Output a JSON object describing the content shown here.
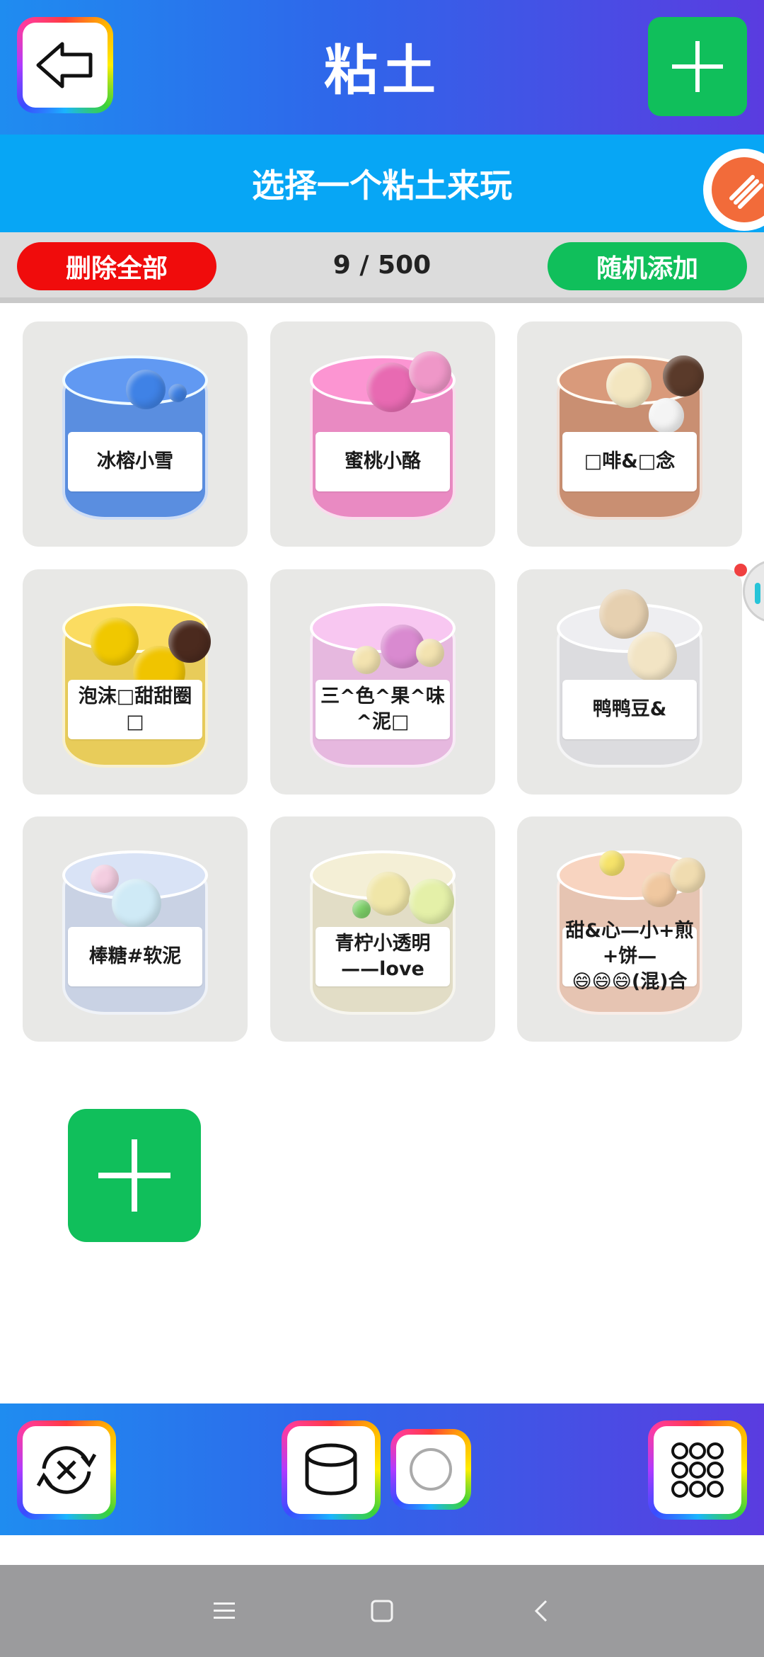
{
  "header": {
    "title": "粘土",
    "back_icon": "arrow-left-icon",
    "add_icon": "plus-icon"
  },
  "subtitle": {
    "text": "选择一个粘土来玩",
    "brush_icon": "brush-icon"
  },
  "controls": {
    "delete_all_label": "删除全部",
    "counter": "9 / 500",
    "random_add_label": "随机添加"
  },
  "slimes": [
    {
      "name": "冰榕小雪",
      "color": "#5a8ee0"
    },
    {
      "name": "蜜桃小酪",
      "color": "#e98ac2"
    },
    {
      "name": "□啡&□念",
      "color": "#c98f72"
    },
    {
      "name": "泡沫□甜甜圈□",
      "color": "#e8cc5a"
    },
    {
      "name": "三^色^果^味^泥□",
      "color": "#e6b8df"
    },
    {
      "name": "鸭鸭豆&",
      "color": "#dcdcdf"
    },
    {
      "name": "棒糖#软泥",
      "color": "#c9d2e4"
    },
    {
      "name": "青柠小透明\n——love",
      "color": "#e2ddc6"
    },
    {
      "name": "甜&心—小+煎+饼—\n😄😄😄(混)合",
      "color": "#e6c4b2"
    }
  ],
  "add_slime_icon": "plus-icon",
  "toolbar": {
    "icons": [
      "reset-icon",
      "jar-icon",
      "circle-icon",
      "grid-icon"
    ]
  },
  "colors": {
    "header_gradient_start": "#1f8cf0",
    "header_gradient_end": "#5a3ce0",
    "subtitle_bg": "#07a6f5",
    "green": "#10bf5b",
    "red": "#f00c0c"
  }
}
